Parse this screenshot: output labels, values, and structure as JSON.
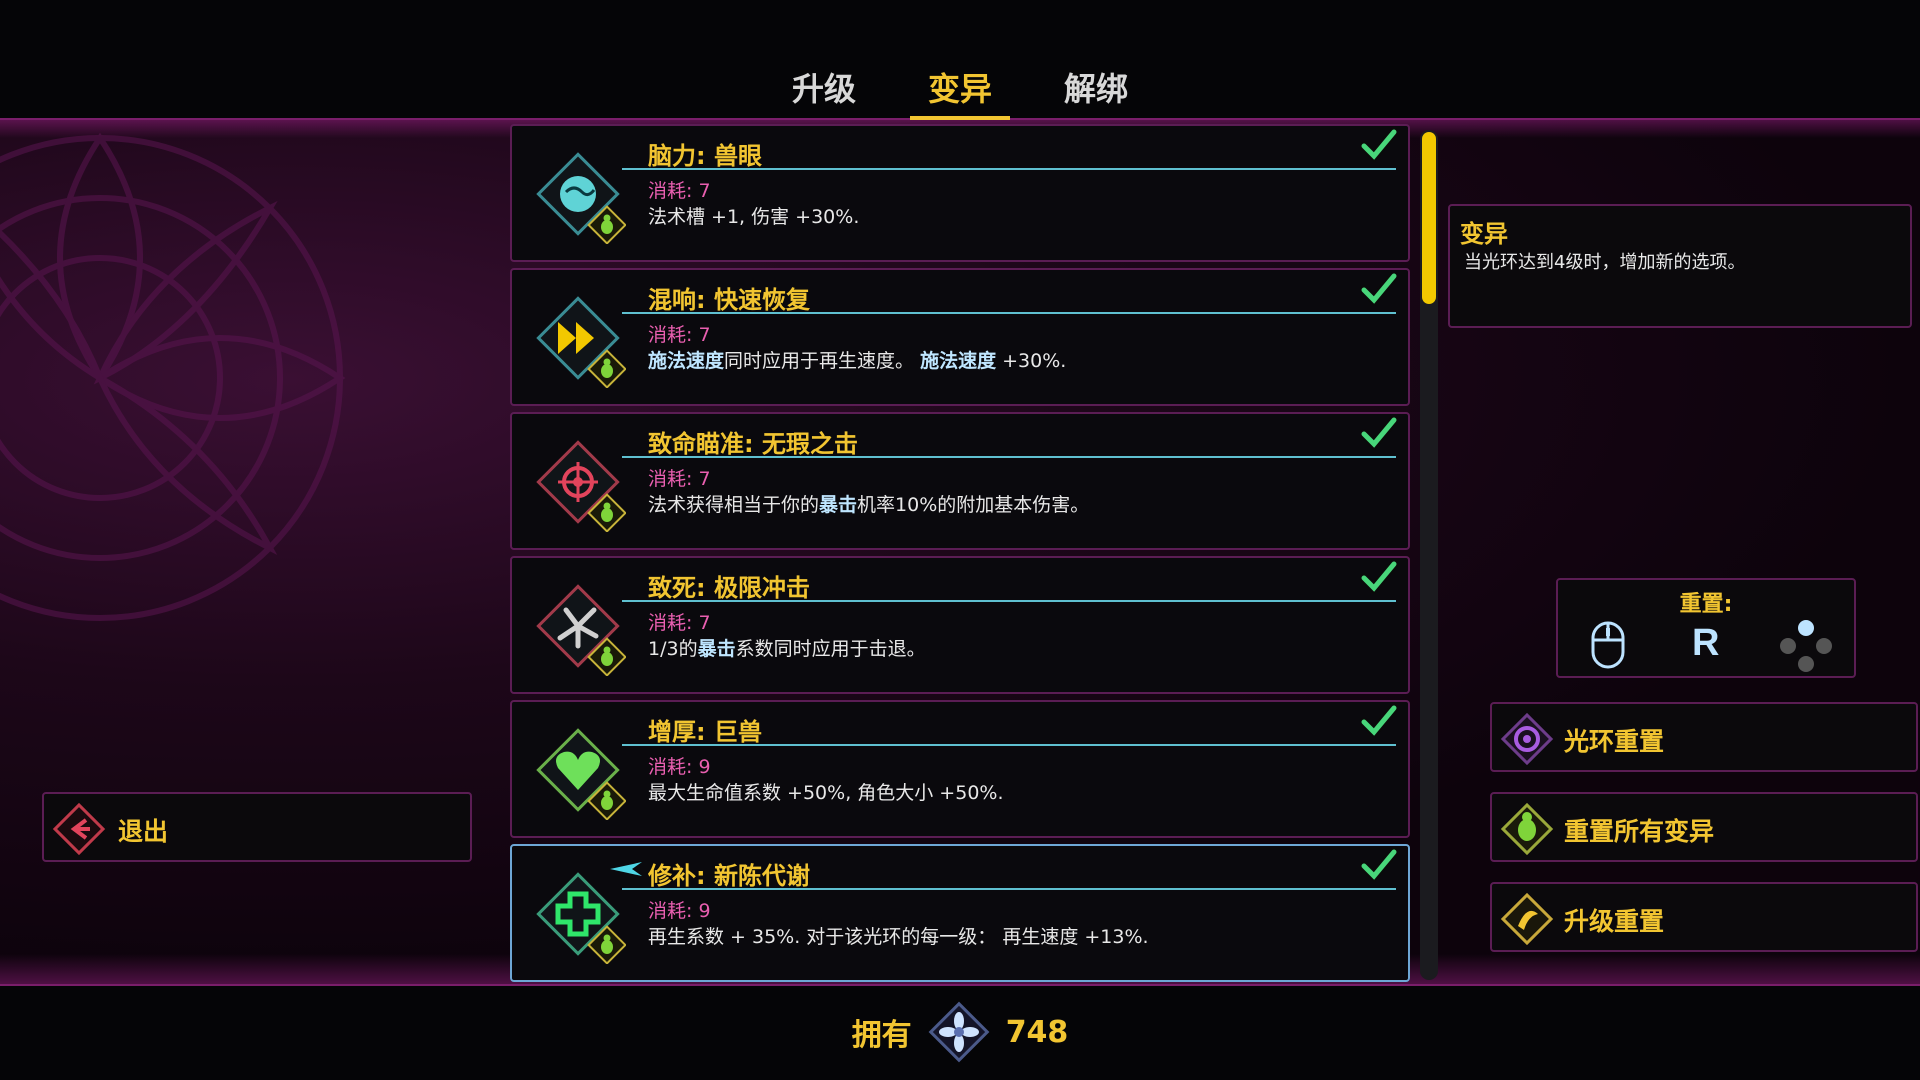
{
  "tabs": [
    {
      "label": "升级",
      "active": false
    },
    {
      "label": "变异",
      "active": true
    },
    {
      "label": "解绑",
      "active": false
    }
  ],
  "mutations": [
    {
      "title": "脑力: 兽眼",
      "cost": "消耗: 7",
      "desc": "法术槽 +1, 伤害 +30%.",
      "icon": "brain-icon",
      "color": "#5fd3d6",
      "checked": true
    },
    {
      "title": "混响: 快速恢复",
      "cost": "消耗: 7",
      "desc_html": "<b>施法速度</b>同时应用于再生速度。 <b>施法速度</b> +30%.",
      "icon": "fast-forward-icon",
      "color": "#f2c800",
      "checked": true
    },
    {
      "title": "致命瞄准: 无瑕之击",
      "cost": "消耗: 7",
      "desc_html": "法术获得相当于你的<b>暴击</b>机率10%的附加基本伤害。",
      "icon": "crosshair-icon",
      "color": "#e2445c",
      "checked": true
    },
    {
      "title": "致死: 极限冲击",
      "cost": "消耗: 7",
      "desc_html": "1/3的<b>暴击</b>系数同时应用于击退。",
      "icon": "impact-icon",
      "color": "#d0d0d0",
      "checked": true
    },
    {
      "title": "增厚: 巨兽",
      "cost": "消耗: 9",
      "desc": "最大生命值系数 +50%, 角色大小 +50%.",
      "icon": "heart-icon",
      "color": "#6ee05a",
      "checked": true
    },
    {
      "title": "修补: 新陈代谢",
      "cost": "消耗: 9",
      "desc": "再生系数 + 35%. 对于该光环的每一级： 再生速度 +13%.",
      "icon": "cross-icon",
      "color": "#2fe66a",
      "checked": true,
      "selected": true
    }
  ],
  "info": {
    "title": "变异",
    "desc": "当光环达到4级时，增加新的选项。"
  },
  "reset": {
    "title": "重置:",
    "key": "R"
  },
  "buttons": {
    "aura_reset": "光环重置",
    "reset_all": "重置所有变异",
    "upgrade_reset": "升级重置",
    "exit": "退出"
  },
  "owned": {
    "label": "拥有",
    "value": "748"
  },
  "colors": {
    "accent": "#f2c531",
    "border": "#5b1d54",
    "cost": "#e95fb0",
    "keyword": "#bfe6ff"
  }
}
